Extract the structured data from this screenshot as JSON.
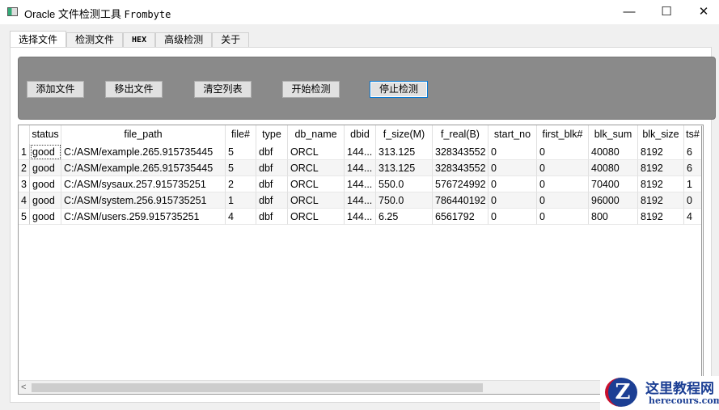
{
  "window": {
    "title_prefix": "Oracle 文件检测工具",
    "title_suffix": "Frombyte",
    "minimize": "—",
    "maximize": "☐",
    "close": "✕"
  },
  "tabs": [
    "选择文件",
    "检测文件",
    "HEX",
    "高级检测",
    "关于"
  ],
  "toolbar": {
    "add": "添加文件",
    "remove": "移出文件",
    "clear": "清空列表",
    "start": "开始检测",
    "stop": "停止检测"
  },
  "table": {
    "headers": [
      "status",
      "file_path",
      "file#",
      "type",
      "db_name",
      "dbid",
      "f_size(M)",
      "f_real(B)",
      "start_no",
      "first_blk#",
      "blk_sum",
      "blk_size",
      "ts#"
    ],
    "rows": [
      {
        "n": "1",
        "cells": [
          "good",
          "C:/ASM/example.265.915735445",
          "5",
          "dbf",
          "ORCL",
          "144...",
          "313.125",
          "328343552",
          "0",
          "0",
          "40080",
          "8192",
          "6"
        ]
      },
      {
        "n": "2",
        "cells": [
          "good",
          "C:/ASM/example.265.915735445",
          "5",
          "dbf",
          "ORCL",
          "144...",
          "313.125",
          "328343552",
          "0",
          "0",
          "40080",
          "8192",
          "6"
        ]
      },
      {
        "n": "3",
        "cells": [
          "good",
          "C:/ASM/sysaux.257.915735251",
          "2",
          "dbf",
          "ORCL",
          "144...",
          "550.0",
          "576724992",
          "0",
          "0",
          "70400",
          "8192",
          "1"
        ]
      },
      {
        "n": "4",
        "cells": [
          "good",
          "C:/ASM/system.256.915735251",
          "1",
          "dbf",
          "ORCL",
          "144...",
          "750.0",
          "786440192",
          "0",
          "0",
          "96000",
          "8192",
          "0"
        ]
      },
      {
        "n": "5",
        "cells": [
          "good",
          "C:/ASM/users.259.915735251",
          "4",
          "dbf",
          "ORCL",
          "144...",
          "6.25",
          "6561792",
          "0",
          "0",
          "800",
          "8192",
          "4"
        ]
      }
    ]
  },
  "watermark": {
    "logo": "Z",
    "cn": "这里教程网",
    "en": "herecours.com"
  }
}
